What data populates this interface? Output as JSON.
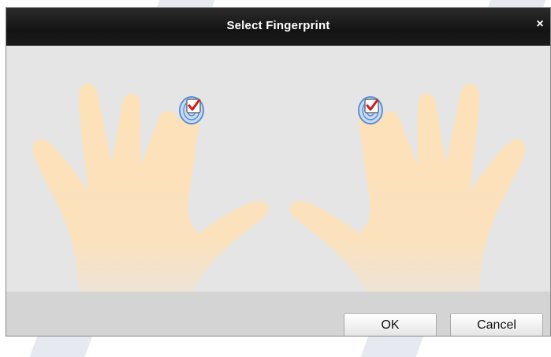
{
  "dialog": {
    "title": "Select Fingerprint",
    "close_label": "×"
  },
  "fingers": {
    "left_hand_index": {
      "checked": true
    },
    "right_hand_index": {
      "checked": true
    }
  },
  "footer": {
    "ok_label": "OK",
    "cancel_label": "Cancel"
  },
  "colors": {
    "hand_fill": "#fde1b8",
    "checkbox_check": "#d61a1a",
    "fingerprint_ring": "#5b8fd6",
    "titlebar": "#1a1a1a"
  }
}
